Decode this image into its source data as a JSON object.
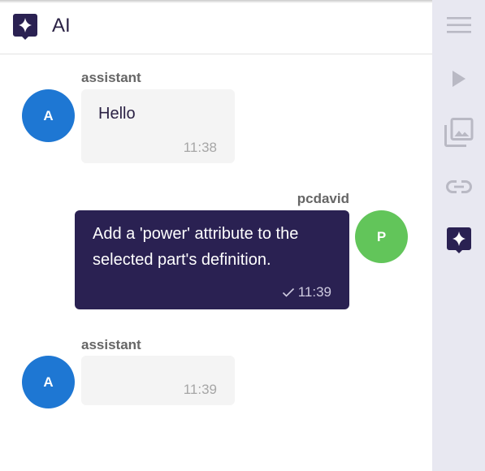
{
  "header": {
    "title": "AI",
    "icon": "ai-sparkle-icon"
  },
  "messages": [
    {
      "sender": "assistant",
      "avatar": "A",
      "text": "Hello",
      "time": "11:38",
      "direction": "incoming"
    },
    {
      "sender": "pcdavid",
      "avatar": "P",
      "text_line1": "Add a 'power' attribute to the",
      "text_line2": "selected part's definition.",
      "time": "11:39",
      "direction": "outgoing",
      "status_icon": "check-icon"
    },
    {
      "sender": "assistant",
      "avatar": "A",
      "text": "",
      "time": "11:39",
      "direction": "incoming"
    }
  ],
  "sidebar": {
    "items": [
      {
        "icon": "menu-icon"
      },
      {
        "icon": "play-icon"
      },
      {
        "icon": "image-gallery-icon"
      },
      {
        "icon": "link-icon"
      },
      {
        "icon": "ai-sparkle-icon",
        "active": true
      }
    ]
  },
  "colors": {
    "brand": "#2a2152",
    "avatar_assistant": "#1e77d3",
    "avatar_user": "#62c55a",
    "sidebar_bg": "#e8e8f1",
    "sidebar_icon": "#b9b9c4"
  }
}
